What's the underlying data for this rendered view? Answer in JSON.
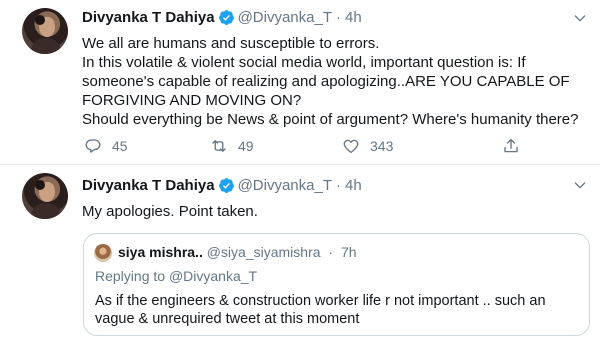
{
  "colors": {
    "accent": "#1da1f2",
    "muted": "#657786",
    "text": "#14171a",
    "border": "#ccd6dd"
  },
  "tweets": [
    {
      "author_name": "Divyanka T Dahiya",
      "handle": "@Divyanka_T",
      "dot": "·",
      "time": "4h",
      "verified_icon": "verified-badge-icon",
      "lines": [
        "We all are humans and susceptible to errors.",
        "In this volatile & violent social media world, important question is: If",
        "someone's capable of realizing and apologizing..ARE YOU CAPABLE OF",
        "FORGIVING AND MOVING ON?",
        "Should everything be News & point of argument? Where's humanity there?"
      ],
      "actions": {
        "replies": "45",
        "retweets": "49",
        "likes": "343"
      }
    },
    {
      "author_name": "Divyanka T Dahiya",
      "handle": "@Divyanka_T",
      "dot": "·",
      "time": "4h",
      "lines": [
        "My apologies. Point taken."
      ],
      "quote": {
        "author_name": "siya mishra..",
        "handle": "@siya_siyamishra",
        "dot": "·",
        "time": "7h",
        "replying_to_label": "Replying to",
        "replying_to_handle": "@Divyanka_T",
        "lines": [
          "As if the engineers & construction worker life r not important .. such an",
          "vague & unrequired tweet at this moment"
        ]
      }
    }
  ]
}
